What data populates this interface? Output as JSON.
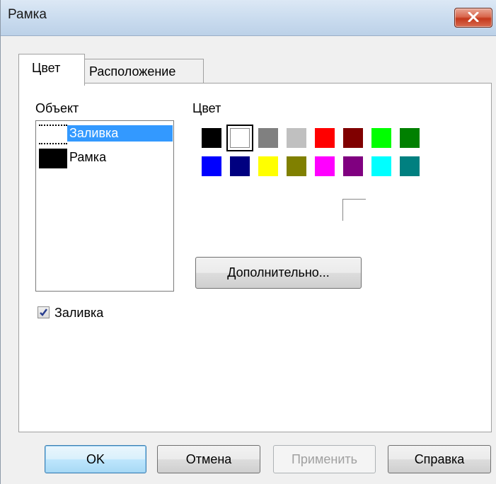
{
  "window": {
    "title": "Рамка"
  },
  "tabs": [
    {
      "label": "Цвет",
      "active": true
    },
    {
      "label": "Расположение",
      "active": false
    }
  ],
  "object_section": {
    "label": "Объект",
    "items": [
      {
        "label": "Заливка",
        "swatch": "#ffffff",
        "selected": true
      },
      {
        "label": "Рамка",
        "swatch": "#000000",
        "selected": false
      }
    ]
  },
  "color_section": {
    "label": "Цвет",
    "palette_row1": [
      "#000000",
      "#ffffff",
      "#808080",
      "#c0c0c0",
      "#ff0000",
      "#800000",
      "#00ff00",
      "#008000"
    ],
    "palette_row2": [
      "#0000ff",
      "#000080",
      "#ffff00",
      "#808000",
      "#ff00ff",
      "#800080",
      "#00ffff",
      "#008080"
    ],
    "selected_color": "#ffffff",
    "more_button": "Дополнительно..."
  },
  "fill_checkbox": {
    "label": "Заливка",
    "checked": true
  },
  "buttons": {
    "ok": "OK",
    "cancel": "Отмена",
    "apply": "Применить",
    "help": "Справка"
  }
}
